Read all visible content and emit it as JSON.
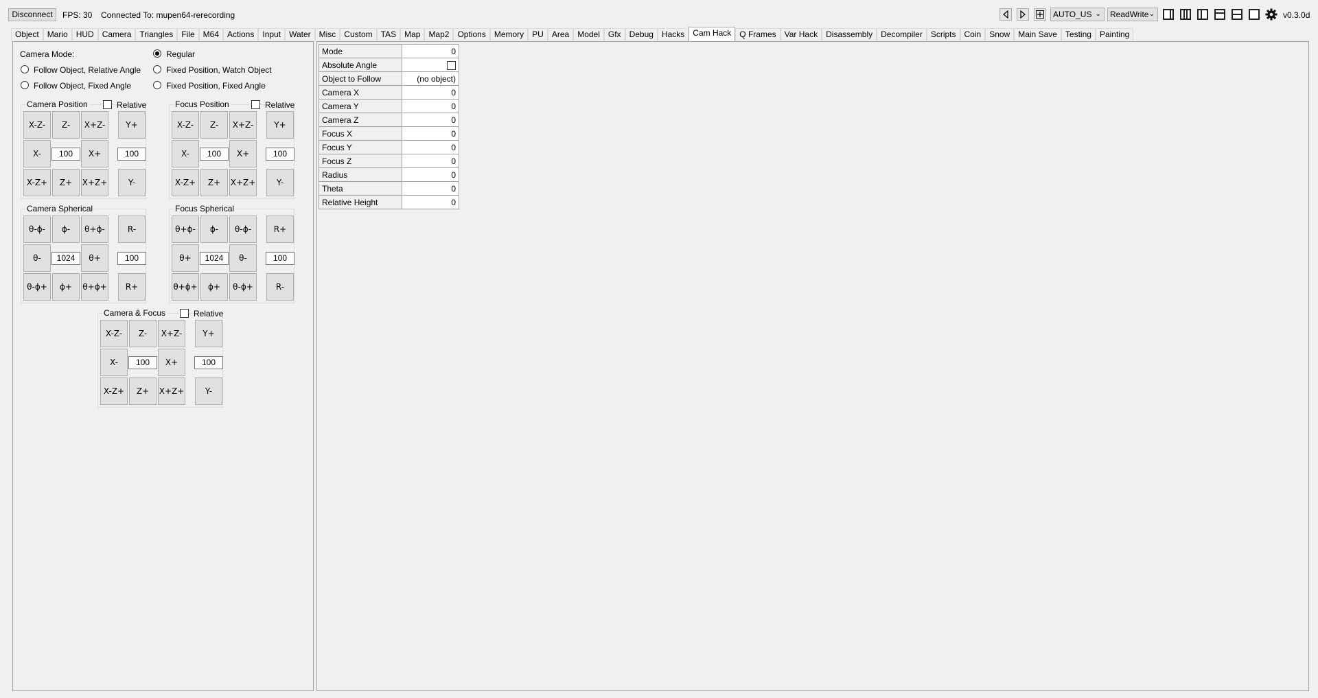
{
  "toolbar": {
    "disconnect_label": "Disconnect",
    "fps_text": "FPS: 30",
    "connected_text": "Connected To: mupen64-rerecording",
    "region_select": "AUTO_US",
    "access_select": "ReadWrite",
    "version": "v0.3.0d",
    "icons": [
      "arrow-left-icon",
      "arrow-right-icon",
      "plus-box-icon",
      "layout-single-icon",
      "layout-dual-icon",
      "layout-left-icon",
      "layout-top-icon",
      "layout-split-horizontal-icon",
      "layout-full-icon",
      "gear-icon"
    ]
  },
  "tabs": [
    "Object",
    "Mario",
    "HUD",
    "Camera",
    "Triangles",
    "File",
    "M64",
    "Actions",
    "Input",
    "Water",
    "Misc",
    "Custom",
    "TAS",
    "Map",
    "Map2",
    "Options",
    "Memory",
    "PU",
    "Area",
    "Model",
    "Gfx",
    "Debug",
    "Hacks",
    "Cam Hack",
    "Q Frames",
    "Var Hack",
    "Disassembly",
    "Decompiler",
    "Scripts",
    "Coin",
    "Snow",
    "Main Save",
    "Testing",
    "Painting"
  ],
  "active_tab": "Cam Hack",
  "camera_mode": {
    "title": "Camera Mode:",
    "options": [
      {
        "label": "Regular",
        "selected": true
      },
      {
        "label": "Follow Object, Relative Angle",
        "selected": false
      },
      {
        "label": "Fixed Position, Watch Object",
        "selected": false
      },
      {
        "label": "Follow Object, Fixed Angle",
        "selected": false
      },
      {
        "label": "Fixed Position, Fixed Angle",
        "selected": false
      }
    ]
  },
  "groups": {
    "camera_position": {
      "title": "Camera Position",
      "relative_label": "Relative",
      "relative": false,
      "buttons": [
        "X-Z-",
        "Z-",
        "X+Z-",
        "X-",
        "X+",
        "X-Z+",
        "Z+",
        "X+Z+",
        "Y+",
        "Y-"
      ],
      "value": "100",
      "y_value": "100"
    },
    "focus_position": {
      "title": "Focus Position",
      "relative_label": "Relative",
      "relative": false,
      "buttons": [
        "X-Z-",
        "Z-",
        "X+Z-",
        "X-",
        "X+",
        "X-Z+",
        "Z+",
        "X+Z+",
        "Y+",
        "Y-"
      ],
      "value": "100",
      "y_value": "100"
    },
    "camera_spherical": {
      "title": "Camera Spherical",
      "buttons": [
        "θ-ϕ-",
        "ϕ-",
        "θ+ϕ-",
        "θ-",
        "θ+",
        "θ-ϕ+",
        "ϕ+",
        "θ+ϕ+",
        "R-",
        "R+"
      ],
      "value": "1024",
      "r_value": "100"
    },
    "focus_spherical": {
      "title": "Focus Spherical",
      "buttons": [
        "θ+ϕ-",
        "ϕ-",
        "θ-ϕ-",
        "θ+",
        "θ-",
        "θ+ϕ+",
        "ϕ+",
        "θ-ϕ+",
        "R+",
        "R-"
      ],
      "value": "1024",
      "r_value": "100"
    },
    "camera_focus": {
      "title": "Camera & Focus",
      "relative_label": "Relative",
      "relative": false,
      "buttons": [
        "X-Z-",
        "Z-",
        "X+Z-",
        "X-",
        "X+",
        "X-Z+",
        "Z+",
        "X+Z+",
        "Y+",
        "Y-"
      ],
      "value": "100",
      "y_value": "100"
    }
  },
  "variables": [
    {
      "name": "Mode",
      "value": "0"
    },
    {
      "name": "Absolute Angle",
      "value": "",
      "checkbox": true
    },
    {
      "name": "Object to Follow",
      "value": "(no object)"
    },
    {
      "name": "Camera X",
      "value": "0"
    },
    {
      "name": "Camera Y",
      "value": "0"
    },
    {
      "name": "Camera Z",
      "value": "0"
    },
    {
      "name": "Focus X",
      "value": "0"
    },
    {
      "name": "Focus Y",
      "value": "0"
    },
    {
      "name": "Focus Z",
      "value": "0"
    },
    {
      "name": "Radius",
      "value": "0"
    },
    {
      "name": "Theta",
      "value": "0"
    },
    {
      "name": "Relative Height",
      "value": "0"
    }
  ]
}
